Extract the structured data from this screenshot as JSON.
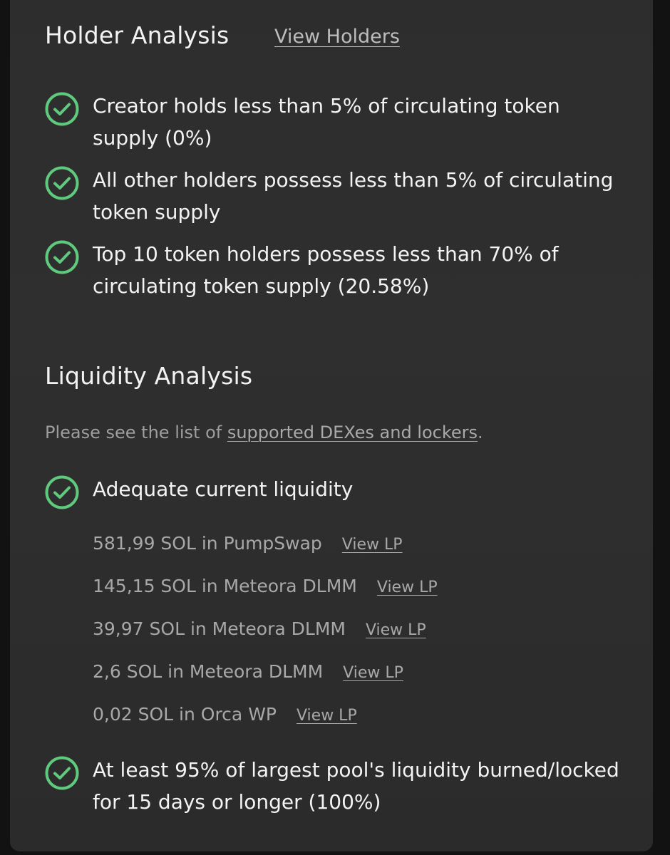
{
  "holder": {
    "title": "Holder Analysis",
    "link": "View Holders",
    "checks": [
      "Creator holds less than 5% of circulating token supply (0%)",
      "All other holders possess less than 5% of circulating token supply",
      "Top 10 token holders possess less than 70% of circulating token supply (20.58%)"
    ]
  },
  "liquidity": {
    "title": "Liquidity Analysis",
    "note_prefix": "Please see the list of ",
    "note_link": "supported DEXes and lockers",
    "note_suffix": ".",
    "check_adequate": "Adequate current liquidity",
    "pools": [
      {
        "text": "581,99 SOL in PumpSwap",
        "link": "View LP"
      },
      {
        "text": "145,15 SOL in Meteora DLMM",
        "link": "View LP"
      },
      {
        "text": "39,97 SOL in Meteora DLMM",
        "link": "View LP"
      },
      {
        "text": "2,6 SOL in Meteora DLMM",
        "link": "View LP"
      },
      {
        "text": "0,02 SOL in Orca WP",
        "link": "View LP"
      }
    ],
    "check_burned": "At least 95% of largest pool's liquidity burned/locked for 15 days or longer (100%)"
  },
  "colors": {
    "check_green": "#5fca7e",
    "card_bg": "#2e2e2e",
    "text_primary": "#f3f3f3",
    "text_muted": "#a8a8a8"
  },
  "icons": {
    "check": "check-circle-icon"
  }
}
